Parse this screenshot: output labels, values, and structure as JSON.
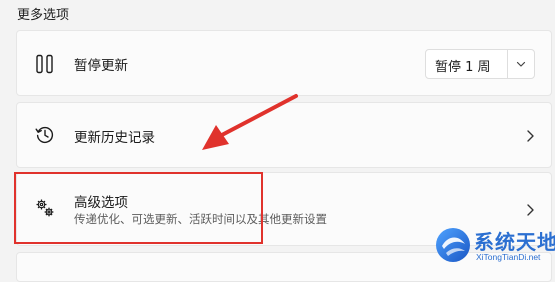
{
  "section": {
    "title": "更多选项"
  },
  "pause_row": {
    "icon": "pause-icon",
    "label": "暂停更新",
    "select_value": "暂停 1 周",
    "dropdown_icon": "chevron-down-icon"
  },
  "history_row": {
    "icon": "history-clock-icon",
    "label": "更新历史记录",
    "chevron_icon": "chevron-right-icon"
  },
  "advanced_row": {
    "icon": "gears-icon",
    "label": "高级选项",
    "description": "传递优化、可选更新、活跃时间以及其他更新设置",
    "chevron_icon": "chevron-right-icon"
  },
  "annotation": {
    "highlight_color": "#e0322c",
    "arrow_color": "#e0322c"
  },
  "watermark": {
    "title": "系统天地",
    "subtitle": "XiTongTianDi.net",
    "color": "#2b6fd1"
  }
}
